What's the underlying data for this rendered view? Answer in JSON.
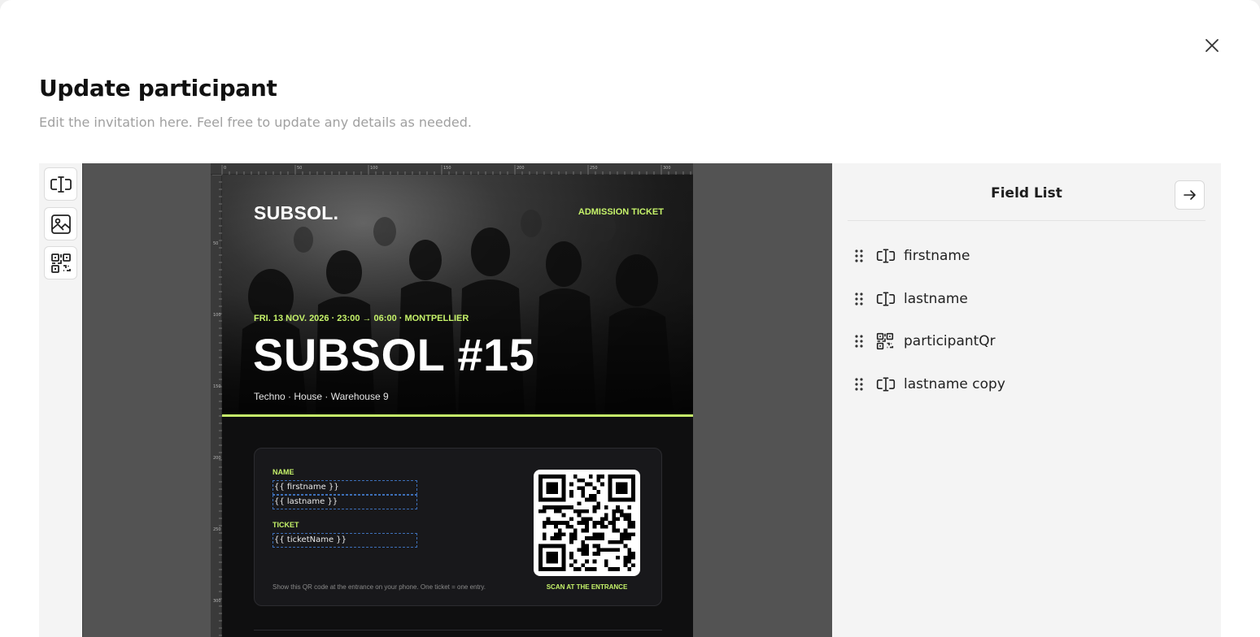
{
  "dialog": {
    "title": "Update participant",
    "subtitle": "Edit the invitation here. Feel free to update any details as needed.",
    "close_icon": "close-icon"
  },
  "toolbar": {
    "tools": [
      {
        "icon": "text-field-icon"
      },
      {
        "icon": "image-icon"
      },
      {
        "icon": "qr-code-icon"
      }
    ]
  },
  "ruler": {
    "top_labels": [
      "0",
      "50",
      "100",
      "150",
      "200",
      "250",
      "300"
    ],
    "left_labels": [
      "50",
      "100",
      "150",
      "200",
      "250",
      "300"
    ]
  },
  "ticket": {
    "brand": "SUBSOL.",
    "admission": "ADMISSION TICKET",
    "dateline": "FRI. 13 NOV. 2026 · 23:00 → 06:00 · MONTPELLIER",
    "event_title": "SUBSOL #15",
    "genres": "Techno · House · Warehouse 9",
    "accent_color": "#c6f36a",
    "card": {
      "name_label": "NAME",
      "firstname_field": "{{ firstname }}",
      "lastname_field": "{{ lastname }}",
      "ticket_label": "TICKET",
      "ticketname_field": "{{ ticketName }}",
      "note": "Show this QR code at the entrance on your phone. One ticket = one entry.",
      "scan_label": "SCAN AT THE ENTRANCE"
    }
  },
  "field_list": {
    "title": "Field List",
    "arrow_icon": "arrow-right-icon",
    "items": [
      {
        "label": "firstname",
        "icon": "text-field-icon"
      },
      {
        "label": "lastname",
        "icon": "text-field-icon"
      },
      {
        "label": "participantQr",
        "icon": "qr-code-icon"
      },
      {
        "label": "lastname copy",
        "icon": "text-field-icon"
      }
    ]
  }
}
